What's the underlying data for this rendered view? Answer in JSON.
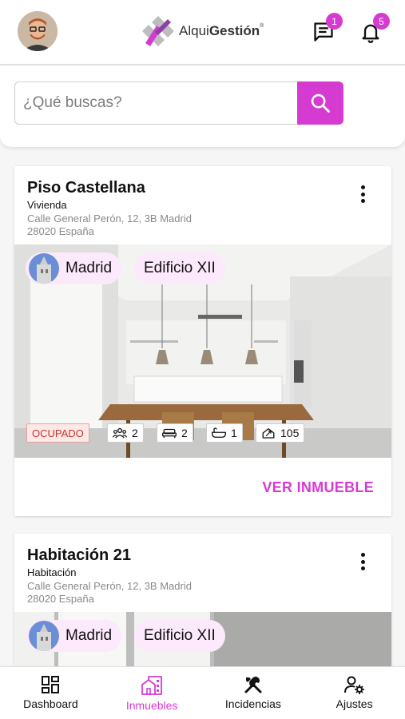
{
  "header": {
    "brand_light": "Alqui",
    "brand_bold": "Gestión",
    "brand_mark": "®",
    "messages_badge": "1",
    "notifications_badge": "5"
  },
  "search": {
    "placeholder": "¿Qué buscas?",
    "value": ""
  },
  "colors": {
    "accent": "#d63bd1",
    "chip_bg": "#fce9fb",
    "status_bg": "#fde8e8"
  },
  "properties": [
    {
      "title": "Piso Castellana",
      "type": "Vivienda",
      "address_line1": "Calle General Perón, 12, 3B Madrid",
      "address_line2": "28020 España",
      "city_chip": "Madrid",
      "building_chip": "Edificio XII",
      "status": "OCUPADO",
      "tenants": "2",
      "bedrooms": "2",
      "bathrooms": "1",
      "area": "105",
      "view_label": "VER INMUEBLE"
    },
    {
      "title": "Habitación 21",
      "type": "Habitación",
      "address_line1": "Calle General Perón, 12, 3B Madrid",
      "address_line2": "28020 España",
      "city_chip": "Madrid",
      "building_chip": "Edificio XII"
    }
  ],
  "nav": [
    {
      "label": "Dashboard",
      "icon": "dashboard-icon",
      "active": false
    },
    {
      "label": "Inmuebles",
      "icon": "building-icon",
      "active": true
    },
    {
      "label": "Incidencias",
      "icon": "tools-icon",
      "active": false
    },
    {
      "label": "Ajustes",
      "icon": "user-settings-icon",
      "active": false
    }
  ]
}
